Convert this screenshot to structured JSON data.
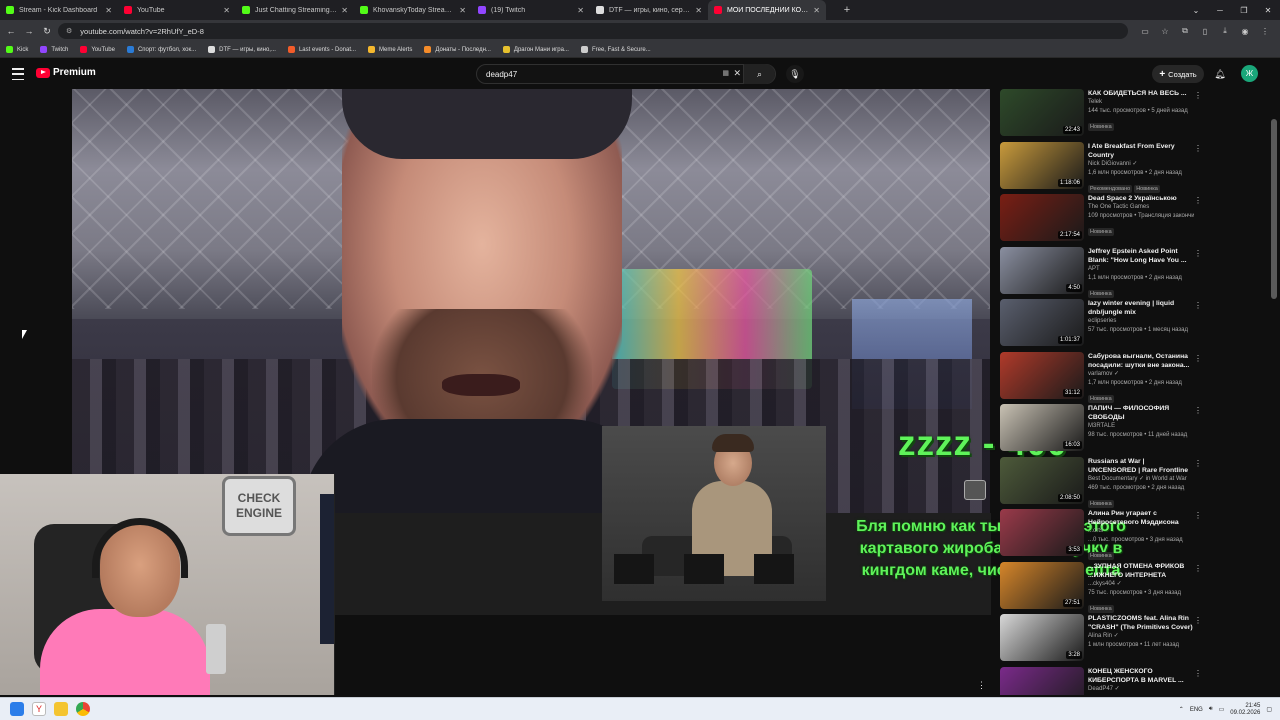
{
  "browser": {
    "tabs": [
      {
        "label": "Stream - Kick Dashboard",
        "color": "#53fc18"
      },
      {
        "label": "YouTube",
        "color": "#ff0033"
      },
      {
        "label": "Just Chatting Streaming - Live S",
        "color": "#53fc18"
      },
      {
        "label": "KhovanskyToday Stream - Watc",
        "color": "#53fc18"
      },
      {
        "label": "(19) Twitch",
        "color": "#9146ff"
      },
      {
        "label": "DTF — игры, кино, сериалы, р",
        "color": "#dddddd"
      },
      {
        "label": "МОЙ ПОСЛЕДНИЙ КОНЦ",
        "color": "#ff0033",
        "active": true
      }
    ],
    "new_tab": "+",
    "url": "youtube.com/watch?v=2RhUfY_eD-8",
    "bookmarks": [
      {
        "label": "Kick",
        "color": "#53fc18"
      },
      {
        "label": "Twitch",
        "color": "#9146ff"
      },
      {
        "label": "YouTube",
        "color": "#ff0033"
      },
      {
        "label": "Спорт: футбол, хок...",
        "color": "#2a7bd6"
      },
      {
        "label": "DTF — игры, кино,...",
        "color": "#dddddd"
      },
      {
        "label": "Last events - Donat...",
        "color": "#f25c2a"
      },
      {
        "label": "Meme Alerts",
        "color": "#f5b82e"
      },
      {
        "label": "Донаты - Последн...",
        "color": "#f58c2a"
      },
      {
        "label": "Драгон Мани игра...",
        "color": "#e6c12e"
      },
      {
        "label": "Free, Fast & Secure...",
        "color": "#cccccc"
      }
    ]
  },
  "youtube": {
    "logo_text": "Premium",
    "search_value": "deadp47",
    "create_label": "Создать",
    "avatar_letter": "Ж"
  },
  "video_overlay": {
    "donation_amount": "zzzz - 400",
    "donation_message": "Бля помню как ты попускал этого картавого жиробаса за озвучку в кингдом каме, чисто рофли епта"
  },
  "webcam": {
    "sign_text": "CHECK ENGINE"
  },
  "recommendations": [
    {
      "title": "КАК ОБИДЕТЬСЯ НА ВЕСЬ ...",
      "channel": "Telek",
      "stats": "144 тыс. просмотров • 5 дней назад",
      "badges": [
        "Новинка"
      ],
      "duration": "22:43",
      "thumb": "#2e4a2a"
    },
    {
      "title": "I Ate Breakfast From Every Country",
      "channel": "Nick DiGiovanni ✓",
      "stats": "1,6 млн просмотров • 2 дня назад",
      "badges": [
        "Рекомендовано",
        "Новинка"
      ],
      "duration": "1:18:06",
      "thumb": "#c89a3c"
    },
    {
      "title": "Dead Space 2 Українською",
      "channel": "The One Tactic Games",
      "stats": "109 просмотров • Трансляция закончи...",
      "badges": [
        "Новинка"
      ],
      "duration": "2:17:54",
      "thumb": "#7a1e14"
    },
    {
      "title": "Jeffrey Epstein Asked Point Blank: \"How Long Have You ...",
      "channel": "APT",
      "stats": "1,1 млн просмотров • 2 дня назад",
      "badges": [
        "Новинка"
      ],
      "duration": "4:50",
      "thumb": "#8a8fa0"
    },
    {
      "title": "lazy winter evening | liquid dnb/jungle mix",
      "channel": "eclipseries",
      "stats": "57 тыс. просмотров • 1 месяц назад",
      "badges": [],
      "duration": "1:01:37",
      "thumb": "#5a5f6e"
    },
    {
      "title": "Сабурова выгнали, Останина посадили: шутки вне закона...",
      "channel": "varlamov ✓",
      "stats": "1,7 млн просмотров • 2 дня назад",
      "badges": [
        "Новинка"
      ],
      "duration": "31:12",
      "thumb": "#b03a2a"
    },
    {
      "title": "ПАПИЧ — ФИЛОСОФИЯ СВОБОДЫ",
      "channel": "M3RTALE",
      "stats": "98 тыс. просмотров • 11 дней назад",
      "badges": [],
      "duration": "16:03",
      "thumb": "#c9c2b4"
    },
    {
      "title": "Russians at War | UNCENSORED | Rare Frontline Access ...",
      "channel": "Best Documentary ✓ in World at War",
      "stats": "469 тыс. просмотров • 2 дня назад",
      "badges": [
        "Новинка"
      ],
      "duration": "2:08:50",
      "thumb": "#4d5a3a"
    },
    {
      "title": "Алина Рин угарает с Нейросетевого Мэддисона",
      "channel": "...orts",
      "stats": "...0 тыс. просмотров • 3 дня назад",
      "badges": [
        "Новинка"
      ],
      "duration": "3:53",
      "thumb": "#9a3a4a"
    },
    {
      "title": "...ЗУПНАЯ ОТМЕНА ФРИКОВ ...ИЖНЕГО ИНТЕРНЕТА",
      "channel": "...ckys404 ✓",
      "stats": "75 тыс. просмотров • 3 дня назад",
      "badges": [
        "Новинка"
      ],
      "duration": "27:51",
      "thumb": "#d6862a"
    },
    {
      "title": "PLASTICZOOMS feat. Alina Rin \"CRASH\" (The Primitives Cover)",
      "channel": "Alina Rin ✓",
      "stats": "1 млн просмотров • 11 лет назад",
      "badges": [],
      "duration": "3:28",
      "thumb": "#d8d8d8"
    },
    {
      "title": "КОНЕЦ ЖЕНСКОГО КИБЕРСПОРТА В MARVEL ...",
      "channel": "DeadP47 ✓",
      "stats": "715 тыс. просмотров • 2 недели назад",
      "badges": [],
      "duration": "15:08",
      "thumb": "#7a2a8a"
    }
  ],
  "taskbar": {
    "lang": "ENG",
    "time": "21:45",
    "date": "09.02.2026"
  }
}
